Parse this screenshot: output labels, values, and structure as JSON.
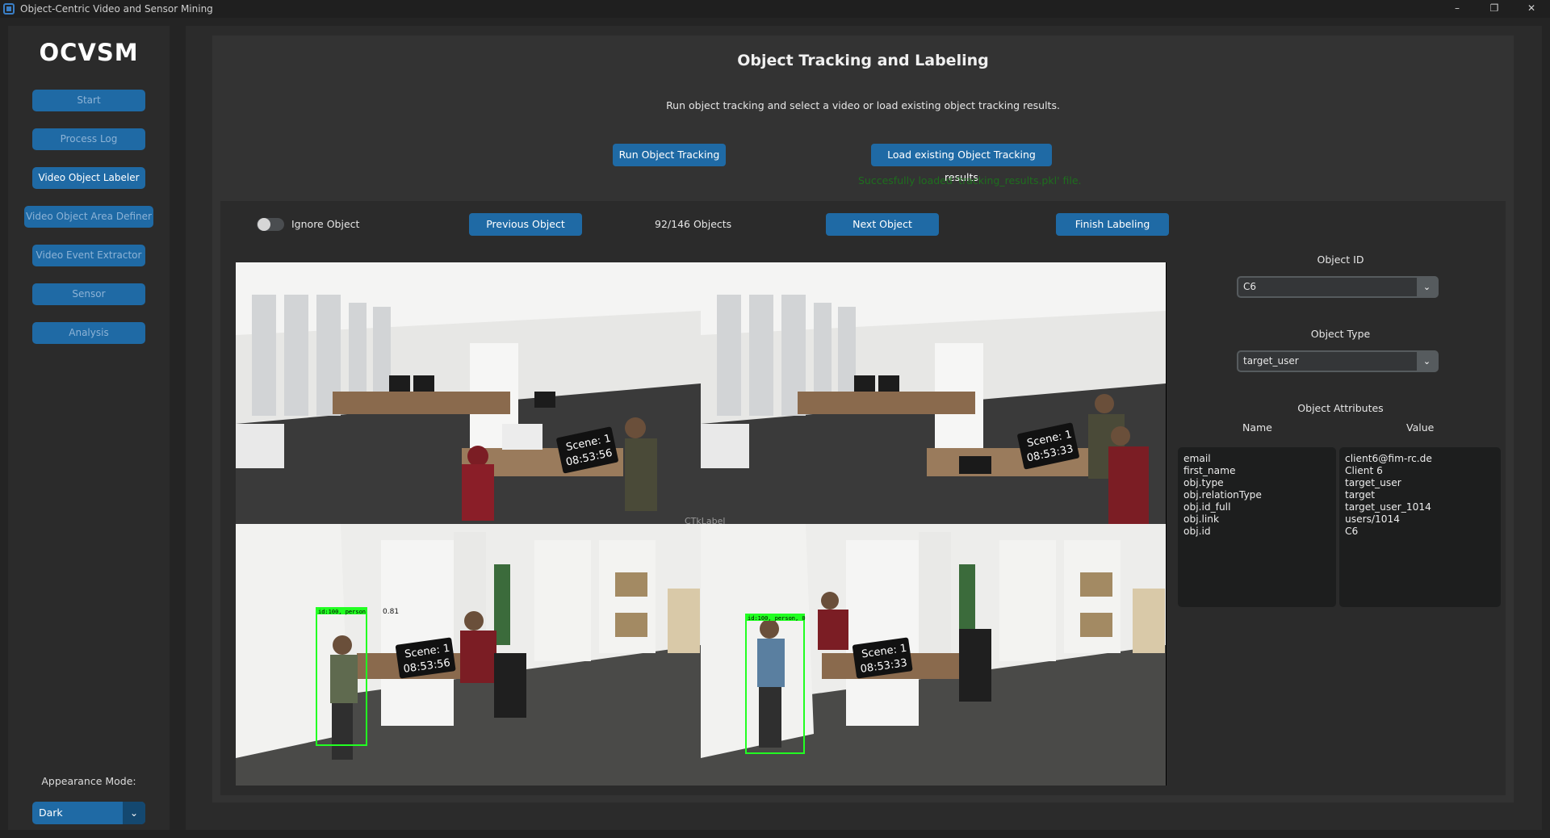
{
  "window": {
    "title": "Object-Centric Video and Sensor Mining",
    "controls": {
      "minimize": "–",
      "restore": "❐",
      "close": "✕"
    }
  },
  "sidebar": {
    "logo": "OCVSM",
    "items": [
      {
        "label": "Start",
        "active": false
      },
      {
        "label": "Process Log",
        "active": false
      },
      {
        "label": "Video Object Labeler",
        "active": true
      },
      {
        "label": "Video Object Area Definer",
        "active": false
      },
      {
        "label": "Video Event Extractor",
        "active": false
      },
      {
        "label": "Sensor",
        "active": false
      },
      {
        "label": "Analysis",
        "active": false
      }
    ],
    "appearance_label": "Appearance Mode:",
    "appearance_value": "Dark",
    "appearance_arrow": "⌄"
  },
  "main": {
    "title": "Object Tracking and Labeling",
    "subtitle": "Run object tracking and select a video or load existing object tracking results.",
    "run_button": "Run Object Tracking",
    "load_button": "Load existing Object Tracking results",
    "status_message": "Succesfully loaded 'tracking_results.pkl' file."
  },
  "labeler": {
    "ignore_label": "Ignore Object",
    "ignore_on": false,
    "prev_button": "Previous Object",
    "counter": "92/146 Objects",
    "next_button": "Next Object",
    "finish_button": "Finish Labeling",
    "ctk_label": "CTkLabel",
    "video_frames": [
      {
        "scene": "Scene: 1",
        "time": "08:53:56"
      },
      {
        "scene": "Scene: 1",
        "time": "08:53:33"
      },
      {
        "scene": "Scene: 1",
        "time": "08:53:56",
        "detection_label": "id:100, person",
        "confidence": "0.81"
      },
      {
        "scene": "Scene: 1",
        "time": "08:53:33",
        "detection_label": "id:100, person, 0"
      }
    ]
  },
  "details": {
    "object_id_label": "Object ID",
    "object_id_value": "C6",
    "object_type_label": "Object Type",
    "object_type_value": "target_user",
    "attributes_label": "Object Attributes",
    "name_header": "Name",
    "value_header": "Value",
    "attr_names": [
      "email",
      "first_name",
      "obj.type",
      "obj.relationType",
      "obj.id_full",
      "obj.link",
      "obj.id"
    ],
    "attr_values": [
      "client6@fim-rc.de",
      "Client 6",
      "target_user",
      "target",
      "target_user_1014",
      "users/1014",
      "C6"
    ],
    "dropdown_arrow": "⌄"
  },
  "colors": {
    "accent": "#1f6aa5",
    "accent_dark": "#144870",
    "success": "#1e6e1e",
    "detection_box": "#22ff22"
  }
}
